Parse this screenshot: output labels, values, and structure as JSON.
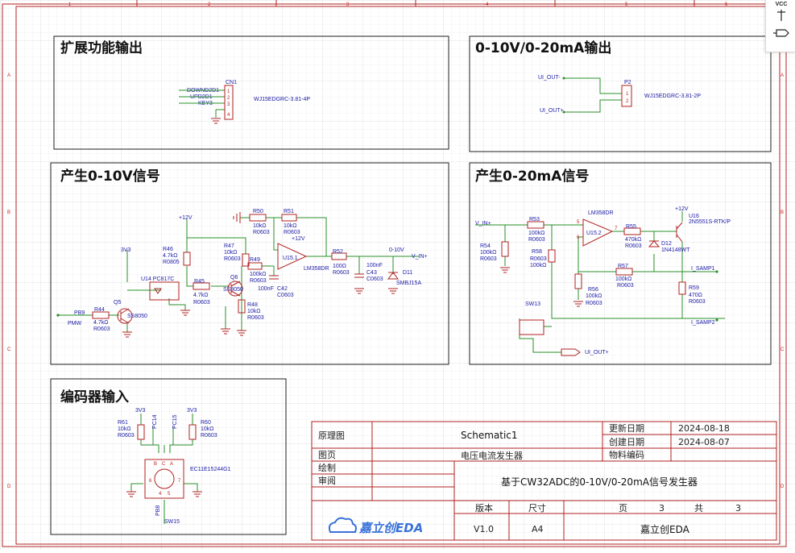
{
  "toolbar": {
    "vcc_label": "VCC"
  },
  "frame": {
    "col_labels": [
      "1",
      "2",
      "3",
      "4",
      "5",
      "6"
    ],
    "row_labels": [
      "A",
      "B",
      "C",
      "D"
    ]
  },
  "blocks": {
    "ext": "扩展功能输出",
    "out": "0-10V/0-20mA输出",
    "v10": "产生0-10V信号",
    "ma20": "产生0-20mA信号",
    "enc": "编码器输入"
  },
  "ext": {
    "cn1": "CN1",
    "cn1_value": "WJ15EDGRC-3.81-4P",
    "nets": [
      "DOWND2D1",
      "UPD2D1",
      "KEY3"
    ],
    "pins": [
      "1",
      "2",
      "3",
      "4"
    ]
  },
  "out": {
    "p2": "P2",
    "p2_value": "WJ15EDGRC-3.81-2P",
    "net_minus": "UI_OUT-",
    "net_plus": "UI_OUT+",
    "pins": [
      "1",
      "2"
    ]
  },
  "v10": {
    "plus12_a": "+12V",
    "plus12_b": "+12V",
    "v3v3": "3V3",
    "r46": [
      "R46",
      "4.7kΩ",
      "R0805"
    ],
    "r47": [
      "R47",
      "10kΩ",
      "R0603"
    ],
    "r50": [
      "R50",
      "10kΩ",
      "R0603"
    ],
    "r51": [
      "R51",
      "10kΩ",
      "R0603"
    ],
    "r49": [
      "R49",
      "100kΩ",
      "R0603"
    ],
    "r45": [
      "R45",
      "4.7kΩ",
      "R0603"
    ],
    "r48": [
      "R48",
      "10kΩ",
      "R0603"
    ],
    "r44": [
      "R44",
      "4.7kΩ",
      "R0603"
    ],
    "r52": [
      "R52",
      "100Ω",
      "R0603"
    ],
    "u14": "U14 PC817C",
    "q5": [
      "Q5",
      "SS8050"
    ],
    "q6": [
      "Q6",
      "SS8050"
    ],
    "u15": [
      "U15.1",
      "LM358DR"
    ],
    "c42": [
      "100nF",
      "C42",
      "C0603"
    ],
    "c43": [
      "100nF",
      "C43",
      "C0603"
    ],
    "d11": [
      "D11",
      "SMBJ15A"
    ],
    "pb9": "PB9",
    "pmw": "PMW",
    "out_label": "0-10V",
    "v_in_plus": "V_IN+"
  },
  "ma20": {
    "v_in_plus": "V_IN+",
    "plus12": "+12V",
    "lm358": "LM358DR",
    "u15": "U15.2",
    "r53": [
      "R53",
      "100kΩ",
      "R0603"
    ],
    "r54": [
      "R54",
      "100kΩ",
      "R0603"
    ],
    "r58": [
      "R58",
      "R0603",
      "100kΩ"
    ],
    "r55": [
      "R55",
      "470kΩ",
      "R0603"
    ],
    "r56": [
      "R56",
      "100kΩ",
      "R0603"
    ],
    "r57": [
      "R57",
      "100kΩ",
      "R0603"
    ],
    "r59": [
      "R59",
      "470Ω",
      "R0603"
    ],
    "d12": [
      "D12",
      "1N4148WT"
    ],
    "u16": [
      "U16",
      "2N5551S-RTK/P"
    ],
    "sw13": "SW13",
    "i_samp1": "I_SAMP1",
    "i_samp2": "I_SAMP2",
    "ui_out_plus": "UI_OUT+",
    "opamp_pins": [
      "5",
      "6",
      "7"
    ]
  },
  "enc": {
    "v3v3_a": "3V3",
    "v3v3_b": "3V3",
    "r61": [
      "R61",
      "10kΩ",
      "R0603"
    ],
    "r60": [
      "R60",
      "10kΩ",
      "R0603"
    ],
    "pc14": "PC14",
    "pc15": "PC15",
    "pb8": "PB8",
    "part": "EC11E15244G1",
    "sw15": "SW15",
    "pins": [
      "B",
      "C",
      "A",
      "6",
      "7",
      "4",
      "5"
    ]
  },
  "title_block": {
    "label_type": "原理图",
    "value_type": "Schematic1",
    "label_page": "图页",
    "value_page": "电压电流发生器",
    "label_draw": "绘制",
    "label_review": "审阅",
    "label_update": "更新日期",
    "value_update": "2024-08-18",
    "label_create": "创建日期",
    "value_create": "2024-08-07",
    "label_part": "物料编码",
    "title": "基于CW32ADC的0-10V/0-20mA信号发生器",
    "label_version": "版本",
    "label_size": "尺寸",
    "label_pg": "页",
    "value_pg": "3",
    "label_total": "共",
    "value_total": "3",
    "value_version": "V1.0",
    "value_size": "A4",
    "company": "嘉立创EDA",
    "logo_text": "嘉立创EDA"
  },
  "colors": {
    "wire": "#2a8f2a",
    "component": "#b22222",
    "label": "#1a1aa6",
    "frame": "#b02020"
  }
}
